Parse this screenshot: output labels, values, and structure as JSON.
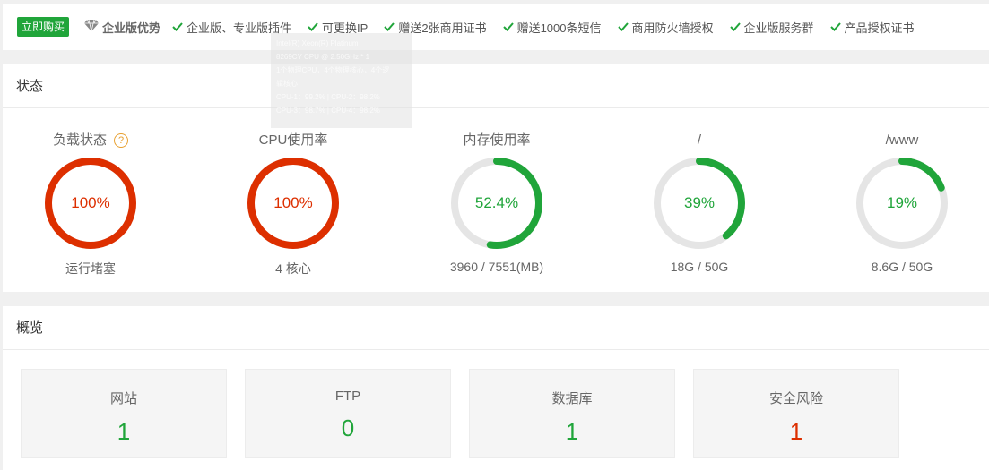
{
  "banner": {
    "buy_label": "立即购买",
    "advantage_title": "企业版优势",
    "features": [
      "企业版、专业版插件",
      "可更换IP",
      "赠送2张商用证书",
      "赠送1000条短信",
      "商用防火墙授权",
      "企业版服务群",
      "产品授权证书"
    ]
  },
  "status": {
    "title": "状态",
    "gauges": [
      {
        "title": "负载状态",
        "value": "100%",
        "percent": 100,
        "sub": "运行堵塞",
        "color": "#dd2f00"
      },
      {
        "title": "CPU使用率",
        "value": "100%",
        "percent": 100,
        "sub": "4 核心",
        "color": "#dd2f00"
      },
      {
        "title": "内存使用率",
        "value": "52.4%",
        "percent": 52.4,
        "sub": "3960 / 7551(MB)",
        "color": "#20a53a"
      },
      {
        "title": "/",
        "value": "39%",
        "percent": 39,
        "sub": "18G / 50G",
        "color": "#20a53a"
      },
      {
        "title": "/www",
        "value": "19%",
        "percent": 19,
        "sub": "8.6G / 50G",
        "color": "#20a53a"
      }
    ]
  },
  "tooltip": {
    "lines": [
      "Intel(R) Xeon(R) Platinum",
      "8269CY CPU @ 2.50GHz * 1",
      "1个物理CPU，4个物理核心，4个逻",
      "辑核心",
      "CPU-1：99.2% | CPU-2：98.2%",
      "CPU-3：98.7% | CPU-4：98.2%"
    ]
  },
  "overview": {
    "title": "概览",
    "cards": [
      {
        "label": "网站",
        "value": "1",
        "color": "#20a53a"
      },
      {
        "label": "FTP",
        "value": "0",
        "color": "#20a53a"
      },
      {
        "label": "数据库",
        "value": "1",
        "color": "#20a53a"
      },
      {
        "label": "安全风险",
        "value": "1",
        "color": "#dd2f00"
      }
    ]
  },
  "colors": {
    "accent": "#20a53a",
    "danger": "#dd2f00",
    "track": "#e5e5e5"
  }
}
